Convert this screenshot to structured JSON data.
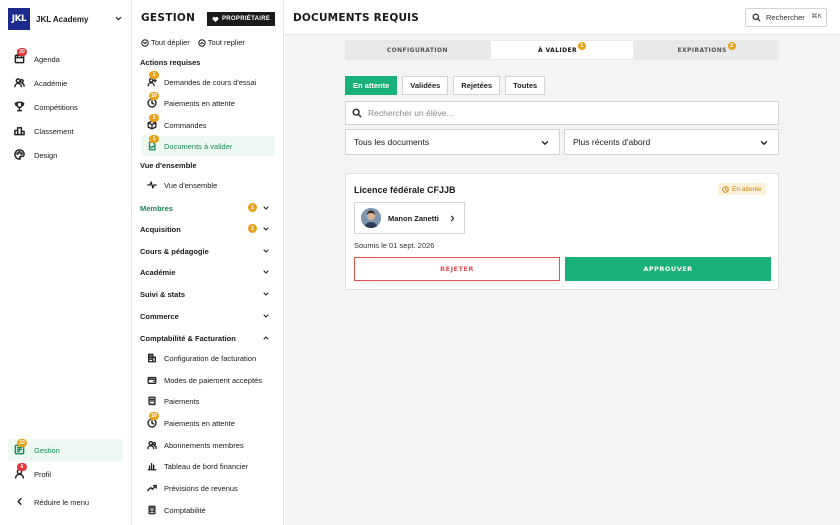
{
  "brand": {
    "logo": "JKL",
    "name": "JKL Academy"
  },
  "sidebar": {
    "items": [
      {
        "label": "Agenda",
        "icon": "calendar-icon",
        "badge": "20"
      },
      {
        "label": "Académie",
        "icon": "users-icon"
      },
      {
        "label": "Compétitions",
        "icon": "trophy-icon"
      },
      {
        "label": "Classement",
        "icon": "podium-icon"
      },
      {
        "label": "Design",
        "icon": "palette-icon"
      }
    ],
    "bottom": [
      {
        "label": "Gestion",
        "icon": "gestion-icon",
        "badge": "23",
        "active": true
      },
      {
        "label": "Profil",
        "icon": "user-icon",
        "badge": "6"
      }
    ],
    "collapse_label": "Réduire le menu"
  },
  "panel": {
    "title": "GESTION",
    "owner_badge": "PROPRIÉTAIRE",
    "expand_all": "Tout déplier",
    "collapse_all": "Tout replier",
    "actions_heading": "Actions requises",
    "actions": [
      {
        "label": "Demandes de cours d'essai",
        "badge": "1"
      },
      {
        "label": "Paiements en attente",
        "badge": "10"
      },
      {
        "label": "Commandes",
        "badge": "3"
      },
      {
        "label": "Documents à valider",
        "badge": "1",
        "active": true
      }
    ],
    "overview_heading": "Vue d'ensemble",
    "overview_item": "Vue d'ensemble",
    "groups": [
      {
        "label": "Membres",
        "badge": "1",
        "green": true
      },
      {
        "label": "Acquisition",
        "badge": "1"
      },
      {
        "label": "Cours & pédagogie"
      },
      {
        "label": "Académie"
      },
      {
        "label": "Suivi & stats"
      },
      {
        "label": "Commerce"
      },
      {
        "label": "Comptabilité & Facturation",
        "open": true
      }
    ],
    "finance_items": [
      {
        "label": "Configuration de facturation"
      },
      {
        "label": "Modes de paiement acceptés"
      },
      {
        "label": "Paiements"
      },
      {
        "label": "Paiements en attente",
        "badge": "10"
      },
      {
        "label": "Abonnements membres"
      },
      {
        "label": "Tableau de bord financier"
      },
      {
        "label": "Prévisions de revenus"
      },
      {
        "label": "Comptabilité"
      }
    ]
  },
  "main": {
    "title": "DOCUMENTS REQUIS",
    "search_label": "Rechercher",
    "search_shortcut": "⌘K",
    "tabs": [
      {
        "label": "CONFIGURATION"
      },
      {
        "label": "À VALIDER",
        "badge": "1",
        "active": true
      },
      {
        "label": "EXPIRATIONS",
        "badge": "2"
      }
    ],
    "filters": [
      "En attente",
      "Validées",
      "Rejetées",
      "Toutes"
    ],
    "active_filter": "En attente",
    "student_search_placeholder": "Rechercher un élève...",
    "doc_type_select": "Tous les documents",
    "sort_select": "Plus récents d'abord",
    "card": {
      "title": "Licence fédérale CFJJB",
      "status": "En attente",
      "student_name": "Manon Zanetti",
      "submitted": "Soumis le 01 sept. 2026",
      "reject_label": "REJETER",
      "approve_label": "APPROUVER"
    }
  },
  "colors": {
    "accent": "#1ab07a",
    "reject": "#e05252",
    "badge_red": "#e0373a",
    "badge_orange": "#e8a31a",
    "brand_blue": "#1b2a8c"
  }
}
